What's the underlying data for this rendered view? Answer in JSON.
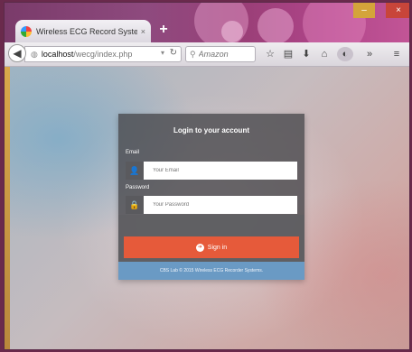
{
  "browser": {
    "tab_title": "Wireless ECG Record Syste...",
    "tab_close": "×",
    "new_tab": "+",
    "url_host": "localhost",
    "url_path": "/wecg/index.php",
    "search_placeholder": "Amazon",
    "window_controls": {
      "minimize": "‒",
      "maximize": "□",
      "close": "×"
    }
  },
  "login": {
    "title": "Login to your account",
    "email_label": "Email",
    "email_placeholder": "Your Email",
    "password_label": "Password",
    "password_placeholder": "Your Password",
    "signin_label": "Sign in",
    "footer": "CBS Lab © 2015 Wireless ECG Recorder Systems."
  },
  "colors": {
    "accent": "#e65a3a",
    "footer": "#6a9ac4",
    "panel": "#464649"
  }
}
